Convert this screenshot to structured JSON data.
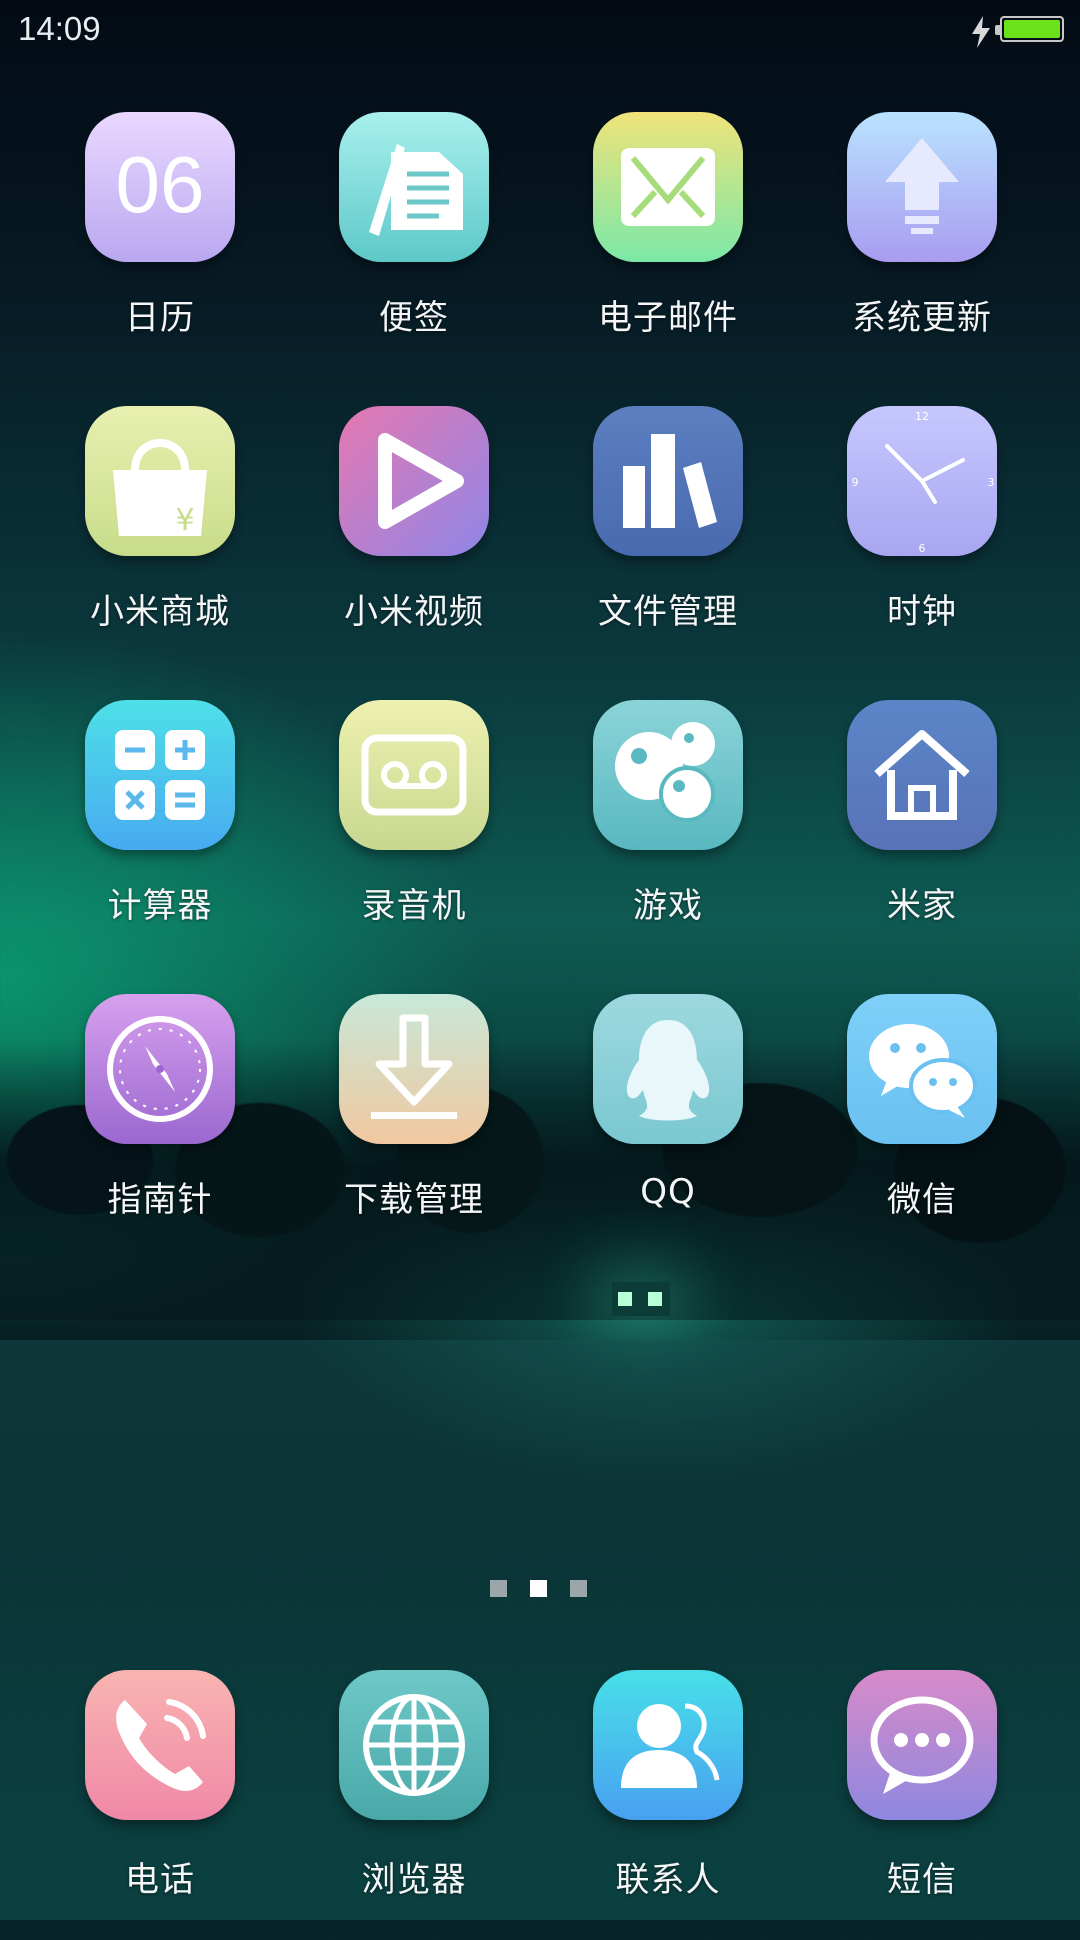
{
  "status_bar": {
    "time": "14:09",
    "charging": true,
    "battery_percent": 100
  },
  "apps": [
    {
      "label": "日历",
      "icon": "calendar-icon",
      "date_number": "06"
    },
    {
      "label": "便签",
      "icon": "notes-icon"
    },
    {
      "label": "电子邮件",
      "icon": "email-icon"
    },
    {
      "label": "系统更新",
      "icon": "system-update-icon"
    },
    {
      "label": "小米商城",
      "icon": "shopping-bag-icon",
      "currency": "¥"
    },
    {
      "label": "小米视频",
      "icon": "video-play-icon"
    },
    {
      "label": "文件管理",
      "icon": "file-manager-icon"
    },
    {
      "label": "时钟",
      "icon": "clock-icon",
      "clock_marks": [
        "12",
        "3",
        "6",
        "9"
      ]
    },
    {
      "label": "计算器",
      "icon": "calculator-icon"
    },
    {
      "label": "录音机",
      "icon": "recorder-icon"
    },
    {
      "label": "游戏",
      "icon": "game-icon"
    },
    {
      "label": "米家",
      "icon": "home-icon"
    },
    {
      "label": "指南针",
      "icon": "compass-icon"
    },
    {
      "label": "下载管理",
      "icon": "download-icon"
    },
    {
      "label": "QQ",
      "icon": "qq-penguin-icon"
    },
    {
      "label": "微信",
      "icon": "wechat-icon"
    }
  ],
  "page_indicator": {
    "total": 3,
    "current": 2
  },
  "dock": [
    {
      "label": "电话",
      "icon": "phone-icon"
    },
    {
      "label": "浏览器",
      "icon": "browser-globe-icon"
    },
    {
      "label": "联系人",
      "icon": "contacts-icon"
    },
    {
      "label": "短信",
      "icon": "messages-icon"
    }
  ]
}
